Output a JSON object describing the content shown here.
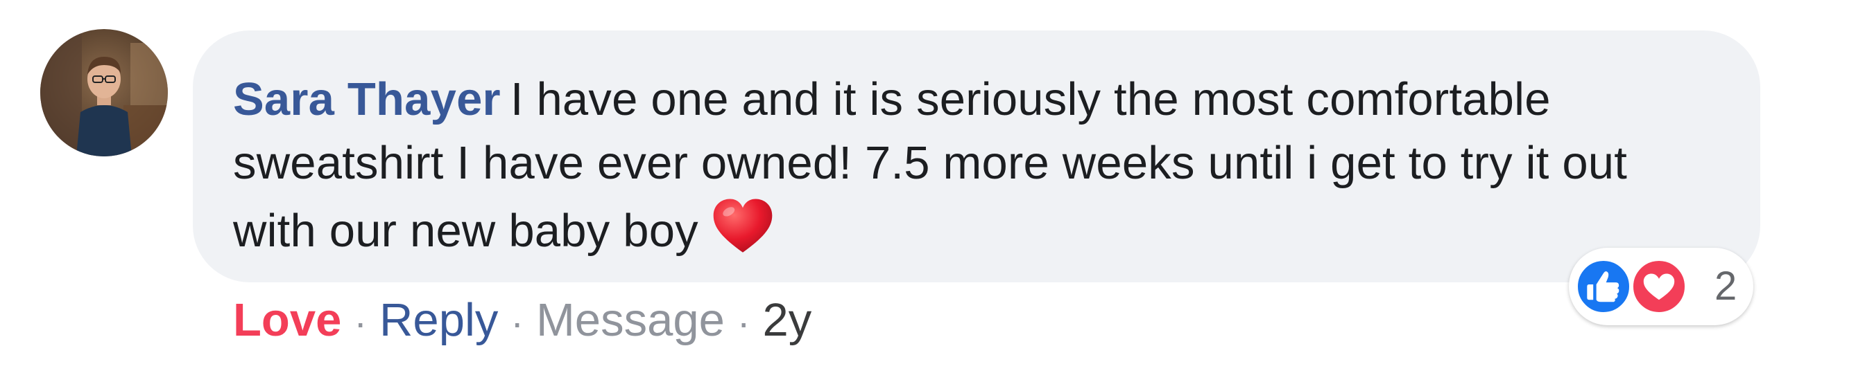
{
  "comment": {
    "author": "Sara Thayer",
    "text": "I have one and it is seriously the most comfortable sweatshirt I have ever owned! 7.5 more weeks until i get to try it out with our new baby boy",
    "emoji": "heart-emoji"
  },
  "reactions": {
    "types": [
      "like-icon",
      "love-icon"
    ],
    "count": "2"
  },
  "actions": {
    "love": "Love",
    "reply": "Reply",
    "message": "Message",
    "timestamp": "2y",
    "separator": "·"
  },
  "colors": {
    "author": "#385898",
    "love": "#f33e58",
    "reply": "#385898",
    "muted": "#90949c",
    "bubble": "#f0f2f5",
    "like_blue": "#1877f2"
  }
}
